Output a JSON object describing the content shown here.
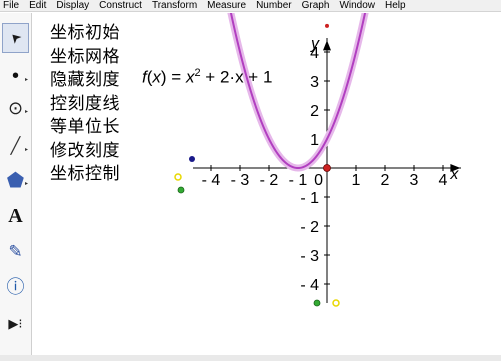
{
  "menu": [
    "File",
    "Edit",
    "Display",
    "Construct",
    "Transform",
    "Measure",
    "Number",
    "Graph",
    "Window",
    "Help"
  ],
  "tools": [
    {
      "name": "arrow-tool-icon",
      "glyph": "➤"
    },
    {
      "name": "point-tool-icon",
      "glyph": "•"
    },
    {
      "name": "compass-tool-icon",
      "glyph": "⊙"
    },
    {
      "name": "straightedge-tool-icon",
      "glyph": "╱"
    },
    {
      "name": "polygon-tool-icon",
      "glyph": "⬟"
    },
    {
      "name": "text-tool-icon",
      "glyph": "A"
    },
    {
      "name": "marker-tool-icon",
      "glyph": "✎"
    },
    {
      "name": "information-tool-icon",
      "glyph": "ⓘ"
    },
    {
      "name": "custom-tool-icon",
      "glyph": "▶⁝"
    }
  ],
  "commands": [
    "坐标初始",
    "坐标网格",
    "隐藏刻度",
    "控刻度线",
    "等单位长",
    "修改刻度",
    "坐标控制"
  ],
  "formula": {
    "fname": "f",
    "var": "x",
    "lhs_tail": ") = ",
    "x_sq": "x",
    "exp": "2",
    "rest": " + 2·x + 1"
  },
  "axes": {
    "x_name": "x",
    "y_name": "y",
    "origin_label": "0",
    "x_ticks": [
      {
        "value": -4,
        "label": "- 4"
      },
      {
        "value": -3,
        "label": "- 3"
      },
      {
        "value": -2,
        "label": "- 2"
      },
      {
        "value": -1,
        "label": "- 1"
      },
      {
        "value": 1,
        "label": "1"
      },
      {
        "value": 2,
        "label": "2"
      },
      {
        "value": 3,
        "label": "3"
      },
      {
        "value": 4,
        "label": "4"
      }
    ],
    "y_ticks": [
      {
        "value": 4,
        "label": "4"
      },
      {
        "value": 3,
        "label": "3"
      },
      {
        "value": 2,
        "label": "2"
      },
      {
        "value": 1,
        "label": "1"
      },
      {
        "value": -1,
        "label": "- 1"
      },
      {
        "value": -2,
        "label": "- 2"
      },
      {
        "value": -3,
        "label": "- 3"
      },
      {
        "value": -4,
        "label": "- 4"
      }
    ]
  },
  "colors": {
    "curve": "#b13fc0",
    "curve_glow": "#e6b8ea",
    "origin_point": "#cc2222",
    "control_blue": "#1a1a8a",
    "control_yellow": "#e8d800",
    "control_green": "#33aa33"
  }
}
